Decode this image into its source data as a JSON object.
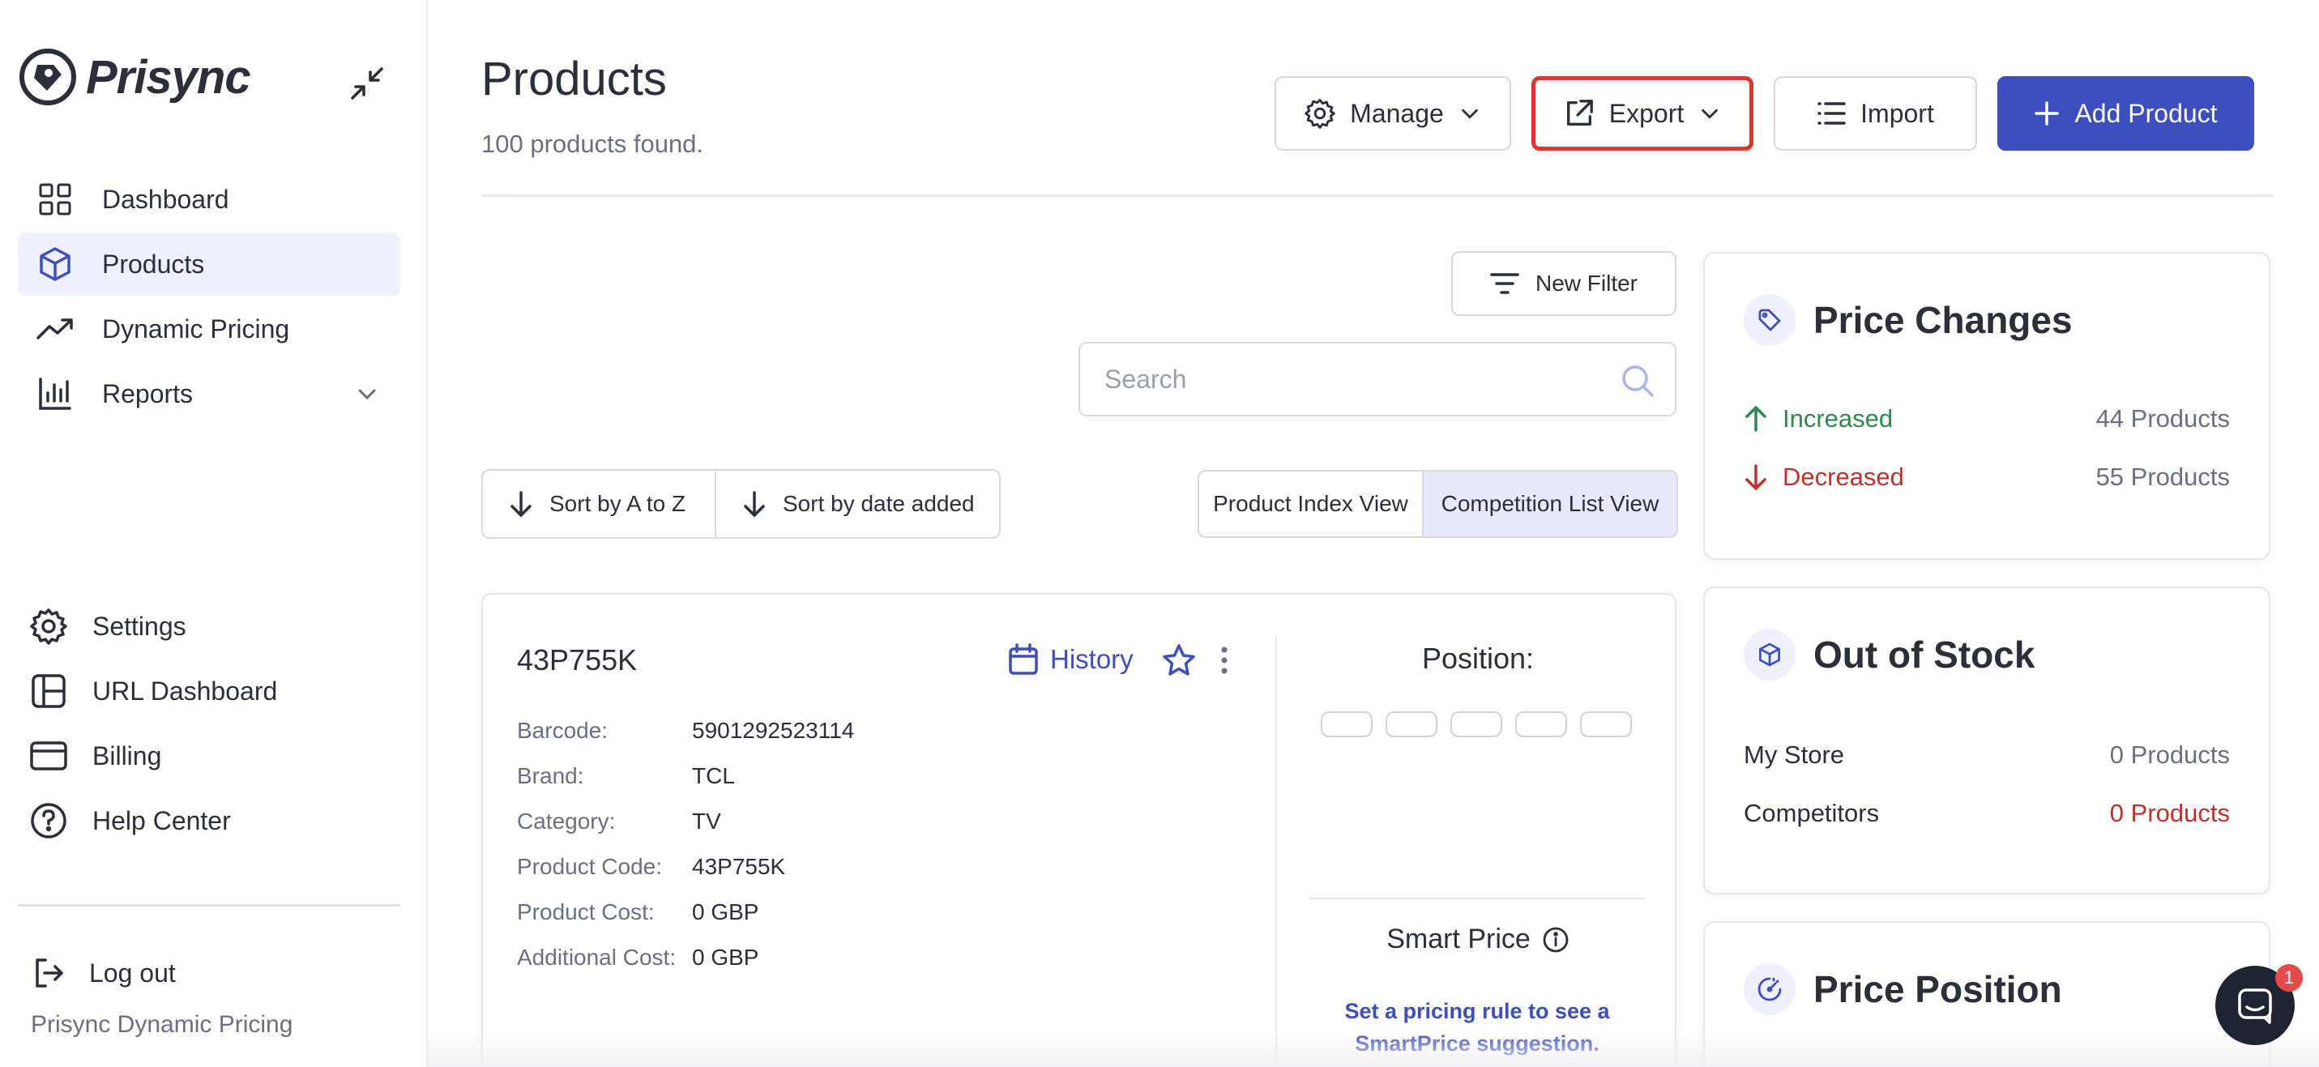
{
  "app": {
    "logo_text": "Prisync",
    "footer_text": "Prisync Dynamic Pricing"
  },
  "sidebar": {
    "items": [
      {
        "label": "Dashboard",
        "icon": "grid-icon"
      },
      {
        "label": "Products",
        "icon": "box-icon",
        "active": true
      },
      {
        "label": "Dynamic Pricing",
        "icon": "trend-icon"
      },
      {
        "label": "Reports",
        "icon": "bar-chart-icon",
        "has_submenu": true
      }
    ],
    "bottom_items": [
      {
        "label": "Settings",
        "icon": "gear-icon"
      },
      {
        "label": "URL Dashboard",
        "icon": "layout-icon"
      },
      {
        "label": "Billing",
        "icon": "credit-card-icon"
      },
      {
        "label": "Help Center",
        "icon": "help-icon"
      }
    ],
    "logout_label": "Log out"
  },
  "header": {
    "title": "Products",
    "subtitle": "100 products found.",
    "manage_label": "Manage",
    "export_label": "Export",
    "import_label": "Import",
    "add_label": "Add Product"
  },
  "filters": {
    "new_filter_label": "New Filter",
    "search_placeholder": "Search",
    "sort_az_label": "Sort by A to Z",
    "sort_date_label": "Sort by date added",
    "view_index_label": "Product Index View",
    "view_competition_label": "Competition List View",
    "active_view": "Competition List View"
  },
  "product": {
    "name": "43P755K",
    "history_label": "History",
    "attributes": [
      {
        "label": "Barcode:",
        "value": "5901292523114"
      },
      {
        "label": "Brand:",
        "value": "TCL"
      },
      {
        "label": "Category:",
        "value": "TV"
      },
      {
        "label": "Product Code:",
        "value": "43P755K"
      },
      {
        "label": "Product Cost:",
        "value": "0 GBP"
      },
      {
        "label": "Additional Cost:",
        "value": "0 GBP"
      }
    ],
    "position_title": "Position:",
    "smart_price_title": "Smart Price",
    "smart_price_hint": "Set a pricing rule to see a SmartPrice suggestion."
  },
  "panels": {
    "price_changes": {
      "title": "Price Changes",
      "increased_label": "Increased",
      "increased_value": "44 Products",
      "decreased_label": "Decreased",
      "decreased_value": "55 Products"
    },
    "out_of_stock": {
      "title": "Out of Stock",
      "my_store_label": "My Store",
      "my_store_value": "0 Products",
      "competitors_label": "Competitors",
      "competitors_value": "0 Products"
    },
    "price_position": {
      "title": "Price Position"
    }
  },
  "chat": {
    "badge": "1"
  },
  "colors": {
    "accent": "#3d4fbf",
    "increase": "#2e8a4d",
    "decrease": "#c0312c",
    "highlight": "#e0332e"
  }
}
